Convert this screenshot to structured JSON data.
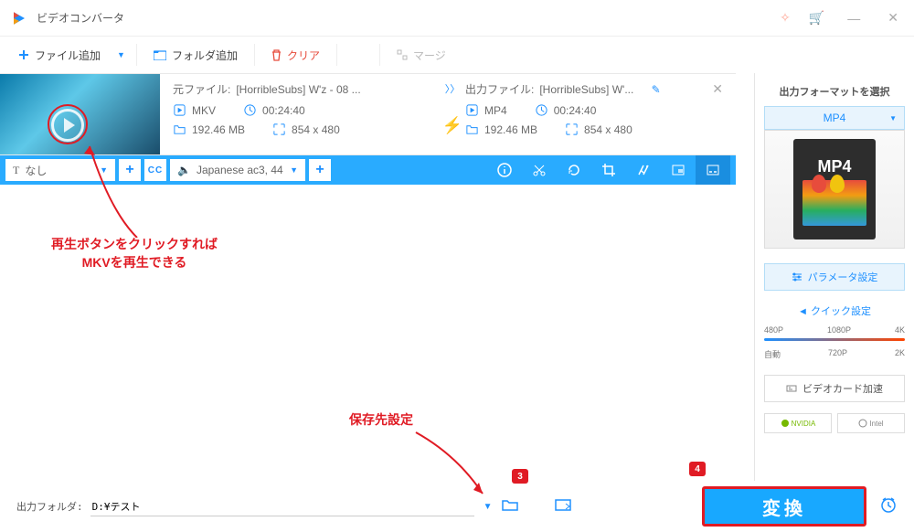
{
  "title": "ビデオコンバータ",
  "toolbar": {
    "add_file": "ファイル追加",
    "add_folder": "フォルダ追加",
    "clear": "クリア",
    "merge": "マージ"
  },
  "source": {
    "label": "元ファイル:",
    "filename": "[HorribleSubs] W'z - 08 ...",
    "format": "MKV",
    "duration": "00:24:40",
    "size": "192.46 MB",
    "resolution": "854 x 480"
  },
  "output": {
    "label": "出力ファイル:",
    "filename": "[HorribleSubs] W'...",
    "format": "MP4",
    "duration": "00:24:40",
    "size": "192.46 MB",
    "resolution": "854 x 480"
  },
  "subtitle": {
    "text": "なし"
  },
  "audio": {
    "text": "Japanese ac3, 44"
  },
  "sidebar": {
    "title": "出力フォーマットを選択",
    "format": "MP4",
    "format_badge": "MP4",
    "param_btn": "パラメータ設定",
    "quick_title": "クイック設定",
    "presets_top": [
      "480P",
      "1080P",
      "4K"
    ],
    "presets_bot": [
      "自動",
      "720P",
      "2K"
    ],
    "gpu_btn": "ビデオカード加速",
    "nvidia": "NVIDIA",
    "intel": "Intel"
  },
  "footer": {
    "label": "出力フォルダ:",
    "path": "D:¥テスト",
    "convert": "変換"
  },
  "annotations": {
    "play": "再生ボタンをクリックすれば\nMKVを再生できる",
    "folder": "保存先設定",
    "badge3": "3",
    "badge4": "4"
  }
}
